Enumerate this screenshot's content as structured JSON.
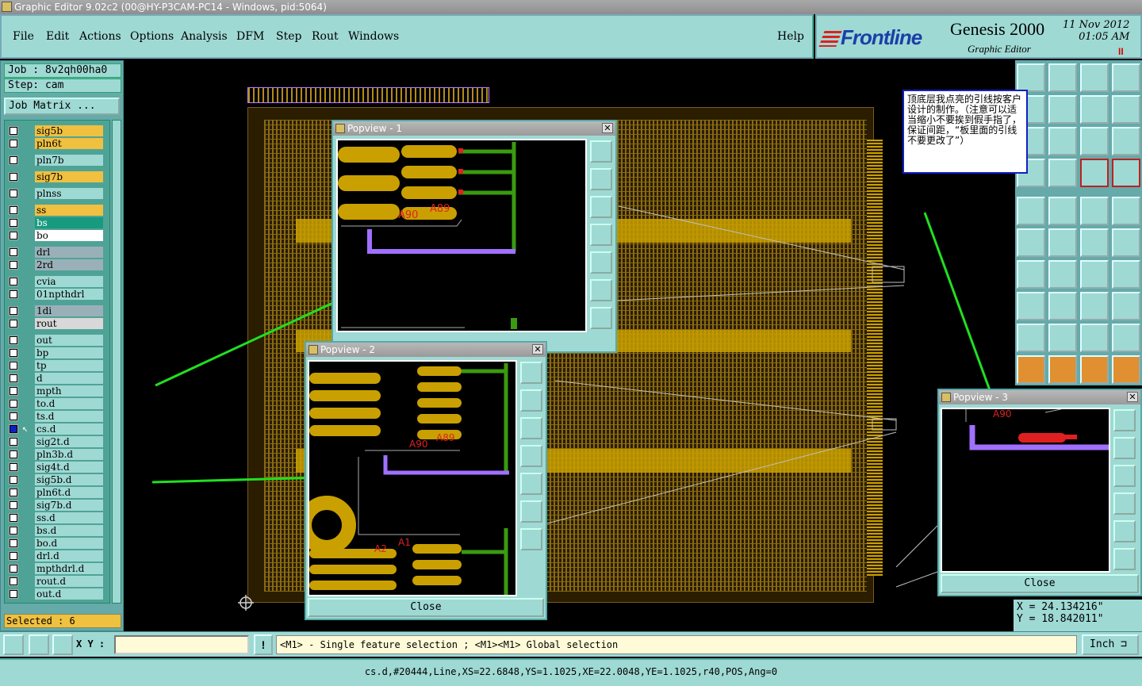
{
  "window": {
    "title": "Graphic Editor 9.02c2 (00@HY-P3CAM-PC14 - Windows, pid:5064)"
  },
  "menu": {
    "items": [
      "File",
      "Edit",
      "Actions",
      "Options",
      "Analysis",
      "DFM",
      "Step",
      "Rout",
      "Windows"
    ],
    "help": "Help"
  },
  "brand": {
    "logo": "Frontline",
    "product": "Genesis 2000",
    "subtitle": "Graphic Editor",
    "date": "11 Nov 2012",
    "time": "01:05 AM",
    "indicator": "II"
  },
  "job": {
    "job": "Job : 8v2qh00ha0",
    "step": "Step: cam",
    "matrix_button": "Job Matrix ..."
  },
  "layers": [
    {
      "name": "sig5b",
      "color": "#f0c040",
      "sig": "◢"
    },
    {
      "name": "pln6t",
      "color": "#f0c040",
      "sig": "◢"
    },
    {
      "name": "pln7b",
      "color": "#9fd9d4",
      "sig": ""
    },
    {
      "name": "sig7b",
      "color": "#f0c040",
      "sig": "◢"
    },
    {
      "name": "plnss",
      "color": "#9fd9d4",
      "sig": ""
    },
    {
      "name": "ss",
      "color": "#f0c040",
      "sig": "◢"
    },
    {
      "name": "bs",
      "color": "#189a7e",
      "sig": ""
    },
    {
      "name": "bo",
      "color": "#ffffff",
      "sig": ""
    },
    {
      "name": "drl",
      "color": "#9ab0b8",
      "sig": ""
    },
    {
      "name": "2rd",
      "color": "#9ab0b8",
      "sig": ""
    },
    {
      "name": "cvia",
      "color": "#9fd9d4",
      "sig": ""
    },
    {
      "name": "01npthdrl",
      "color": "#9fd9d4",
      "sig": ""
    },
    {
      "name": "1di",
      "color": "#9ab0b8",
      "sig": ""
    },
    {
      "name": "rout",
      "color": "#d8d8d8",
      "sig": ""
    },
    {
      "name": "out",
      "color": "#9fd9d4",
      "sig": "◢"
    },
    {
      "name": "bp",
      "color": "#9fd9d4",
      "sig": ""
    },
    {
      "name": "tp",
      "color": "#9fd9d4",
      "sig": ""
    },
    {
      "name": "d",
      "color": "#9fd9d4",
      "sig": ""
    },
    {
      "name": "mpth",
      "color": "#9fd9d4",
      "sig": ""
    },
    {
      "name": "to.d",
      "color": "#9fd9d4",
      "sig": "◢"
    },
    {
      "name": "ts.d",
      "color": "#9fd9d4",
      "sig": ""
    },
    {
      "name": "cs.d",
      "color": "#9fd9d4",
      "sig": "◢▣"
    },
    {
      "name": "sig2t.d",
      "color": "#9fd9d4",
      "sig": "◢"
    },
    {
      "name": "pln3b.d",
      "color": "#9fd9d4",
      "sig": "◢"
    },
    {
      "name": "sig4t.d",
      "color": "#9fd9d4",
      "sig": "◢"
    },
    {
      "name": "sig5b.d",
      "color": "#9fd9d4",
      "sig": "◢"
    },
    {
      "name": "pln6t.d",
      "color": "#9fd9d4",
      "sig": "◢"
    },
    {
      "name": "sig7b.d",
      "color": "#9fd9d4",
      "sig": "◢"
    },
    {
      "name": "ss.d",
      "color": "#9fd9d4",
      "sig": "◢"
    },
    {
      "name": "bs.d",
      "color": "#9fd9d4",
      "sig": ""
    },
    {
      "name": "bo.d",
      "color": "#9fd9d4",
      "sig": ""
    },
    {
      "name": "drl.d",
      "color": "#9fd9d4",
      "sig": ""
    },
    {
      "name": "mpthdrl.d",
      "color": "#9fd9d4",
      "sig": ""
    },
    {
      "name": "rout.d",
      "color": "#9fd9d4",
      "sig": ""
    },
    {
      "name": "out.d",
      "color": "#9fd9d4",
      "sig": ""
    }
  ],
  "selected": "Selected : 6",
  "popviews": [
    {
      "title": "Popview - 1",
      "labels": [
        "A90",
        "A89"
      ],
      "close": ""
    },
    {
      "title": "Popview - 2",
      "labels": [
        "A90",
        "A89",
        "A2",
        "A1"
      ],
      "close": "Close"
    },
    {
      "title": "Popview - 3",
      "labels": [
        "A90"
      ],
      "close": "Close"
    }
  ],
  "annotation": "顶底层我点亮的引线按客户设计的制作。（注意可以适当缩小不要挨到假手指了，保证间距，“板里面的引线不要更改了”）",
  "coords": {
    "x": "X = 24.134216\"",
    "y": "Y = 18.842011\""
  },
  "bottom": {
    "xy_label": "X Y :",
    "xy_value": "",
    "warn": "!",
    "message": "<M1> - Single feature selection ; <M1><M1> Global selection",
    "units": "Inch ⊐"
  },
  "status": "cs.d,#20444,Line,XS=22.6848,YS=1.1025,XE=22.0048,YE=1.1025,r40,POS,Ang=0",
  "colors": {
    "panel": "#9fd9d4",
    "highlight": "#f0c040",
    "copper": "#c9a000",
    "trace": "#a070ff",
    "green": "#20e020"
  }
}
